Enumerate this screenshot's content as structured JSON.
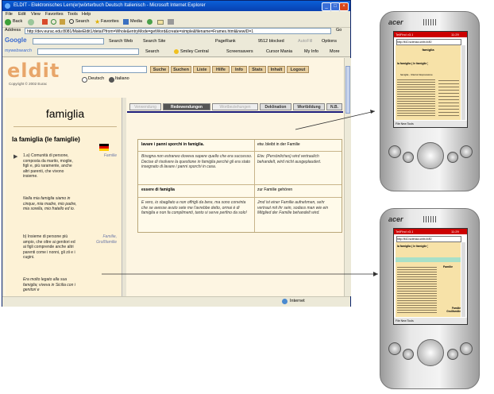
{
  "browser": {
    "title": "ELDIT - Elektronisches Lern(er)wörterbuch Deutsch Italienisch - Microsoft Internet Explorer",
    "window_controls": [
      "_",
      "□",
      "×"
    ],
    "menu": [
      "File",
      "Edit",
      "View",
      "Favorites",
      "Tools",
      "Help"
    ],
    "toolbar": {
      "back": "Back",
      "search": "Search",
      "favorites": "Favorites",
      "media": "Media"
    },
    "address": {
      "label": "Address",
      "url": "http://dev.eurac.edu:8081/MakeEldit1/detail?from=Whole&entryMode=getWord&create=simple&filename=Frames.html&newID=1",
      "go": "Go"
    },
    "google": {
      "label": "Google",
      "search_web": "Search Web",
      "search_site": "Search Site",
      "pagerank": "PageRank",
      "blocked": "9512 blocked",
      "autofill": "AutoFill",
      "options": "Options"
    },
    "websearch": {
      "label": "mywebsearch",
      "search": "Search",
      "smiley": "Smiley Central",
      "screensavers": "Screensavers",
      "cursor": "Cursor Mania",
      "myinfo": "My Info",
      "more": "More"
    },
    "status": {
      "zone": "Internet"
    }
  },
  "eldit": {
    "logo": "eldit",
    "copyright": "Copyright © 2002 Eurac",
    "lang_de": "Deutsch",
    "lang_it": "Italiano",
    "top_buttons": [
      "Suche",
      "Suchen",
      "Liste",
      "Hilfe",
      "Info",
      "Stats",
      "Inhalt",
      "Logout"
    ],
    "lemma": "famiglia",
    "headword": "la famiglia (le famiglie)",
    "tabs": [
      "Verwendung",
      "Redewendungen",
      "Wortbeziehungen",
      "Deklination",
      "Wortbildung",
      "N.B."
    ],
    "meanings": [
      {
        "text": "1.a) Comunità di persone, composta da marito, moglie, figli e, più raramente, anche altri parenti, che vivono insieme.",
        "gloss": "Familie"
      },
      {
        "text": "Nella mia famiglia siamo in cinque, mia madre, mio padre, mia sorella, mio fratello ed io.",
        "gloss": ""
      },
      {
        "text": "b) Insieme di persone più ampio, che oltre ai genitori ed ai figli comprende anche altri parenti come i nonni, gli zii e i cugini.",
        "gloss": "Familie, Großfamilie"
      },
      {
        "text": "Era molto legato alla sua famiglia; viveva in Sicilia con i genitori e",
        "gloss": ""
      }
    ],
    "idioms": [
      {
        "it": "lavare i panni sporchi in famiglia.",
        "de": "etw. bleibt in der Familie"
      },
      {
        "it": "Bisogna non estraneo doveva sapere quello che era successo. Decise di risolvere la questione in famiglia perché gli era stato insegnato di lavare i panni sporchi in casa.",
        "de": "Etw. (Persönliches) wird vertraulich behandelt, wird nicht ausgeplaudert."
      },
      {
        "it": "essere di famiglia",
        "de": "zur Familie gehören"
      },
      {
        "it": "È vero, io sbagliato a non offrigli da bere, ma sono convinta che se avesse avuto sete me l'avrebbe detto, ormai è di famiglia e non fa complimenti, tanto si serve perfino da solo!",
        "de": "Jmd ist einer Familie aufnehmen, sehr vertraut mit ihr sein, sodass man wie ein Mitglied der Familie behandelt wird."
      }
    ]
  },
  "pda_top": {
    "brand": "acer",
    "app_title": "TellFind v3.1",
    "time": "11:29",
    "url": "http://it10.scienza.unitn.it:80",
    "header": "famiglia",
    "subhead": "la famiglia ( le famiglie )",
    "section": "famiglia - Ulteriori Espressione",
    "menu": "File  New  Tools"
  },
  "pda_bottom": {
    "brand": "acer",
    "app_title": "TellFind v3.1",
    "time": "11:29",
    "url": "http://it10.scienza.unitn.it:80",
    "subhead": "la famiglia ( le famiglie )",
    "menu": "File  New  Tools",
    "gloss1": "Familie",
    "gloss2": "Familie Großfamilie"
  },
  "colors": {
    "logo": "#e8a66a",
    "content_bg": "#fdf5e2",
    "tab_active": "#555555",
    "titlebar": "#0a5fd8",
    "pda_header": "#cc0000"
  }
}
